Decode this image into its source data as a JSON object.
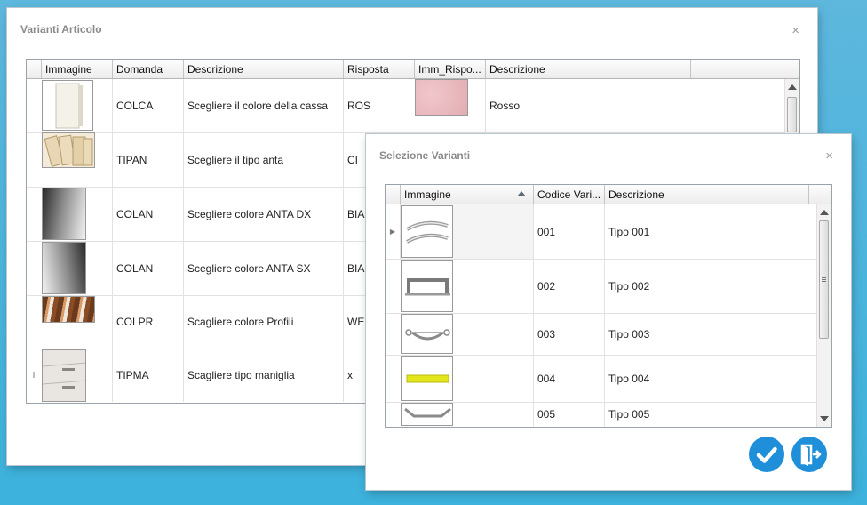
{
  "win1": {
    "title": "Varianti Articolo",
    "close": "×",
    "headers": [
      "Immagine",
      "Domanda",
      "Descrizione",
      "Risposta",
      "Imm_Rispo...",
      "Descrizione"
    ],
    "rows": [
      {
        "domanda": "COLCA",
        "descrizione": "Scegliere il colore della cassa",
        "risposta": "ROS",
        "desc2": "Rosso"
      },
      {
        "domanda": "TIPAN",
        "descrizione": "Scegliere il tipo anta",
        "risposta": "CI",
        "desc2": ""
      },
      {
        "domanda": "COLAN",
        "descrizione": "Scegliere colore ANTA DX",
        "risposta": "BIA",
        "desc2": ""
      },
      {
        "domanda": "COLAN",
        "descrizione": "Scegliere colore ANTA SX",
        "risposta": "BIA",
        "desc2": ""
      },
      {
        "domanda": "COLPR",
        "descrizione": "Scagliere colore Profili",
        "risposta": "WEN",
        "desc2": ""
      },
      {
        "domanda": "TIPMA",
        "descrizione": "Scagliere tipo maniglia",
        "risposta": "x",
        "desc2": ""
      }
    ],
    "edit_marker": "I"
  },
  "win2": {
    "title": "Selezione Varianti",
    "close": "×",
    "headers": [
      "Immagine",
      "Codice Vari...",
      "Descrizione"
    ],
    "rows": [
      {
        "codice": "001",
        "descrizione": "Tipo 001"
      },
      {
        "codice": "002",
        "descrizione": "Tipo 002"
      },
      {
        "codice": "003",
        "descrizione": "Tipo 003"
      },
      {
        "codice": "004",
        "descrizione": "Tipo 004"
      },
      {
        "codice": "005",
        "descrizione": "Tipo 005"
      }
    ],
    "current_row_marker": "▶"
  },
  "colors": {
    "accent": "#1e8fd8",
    "swatch_rosso": "#e6b4b8",
    "handle_yellow": "#e2e61a"
  },
  "icons": {
    "confirm": "checkmark-icon",
    "exit": "exit-door-icon"
  }
}
